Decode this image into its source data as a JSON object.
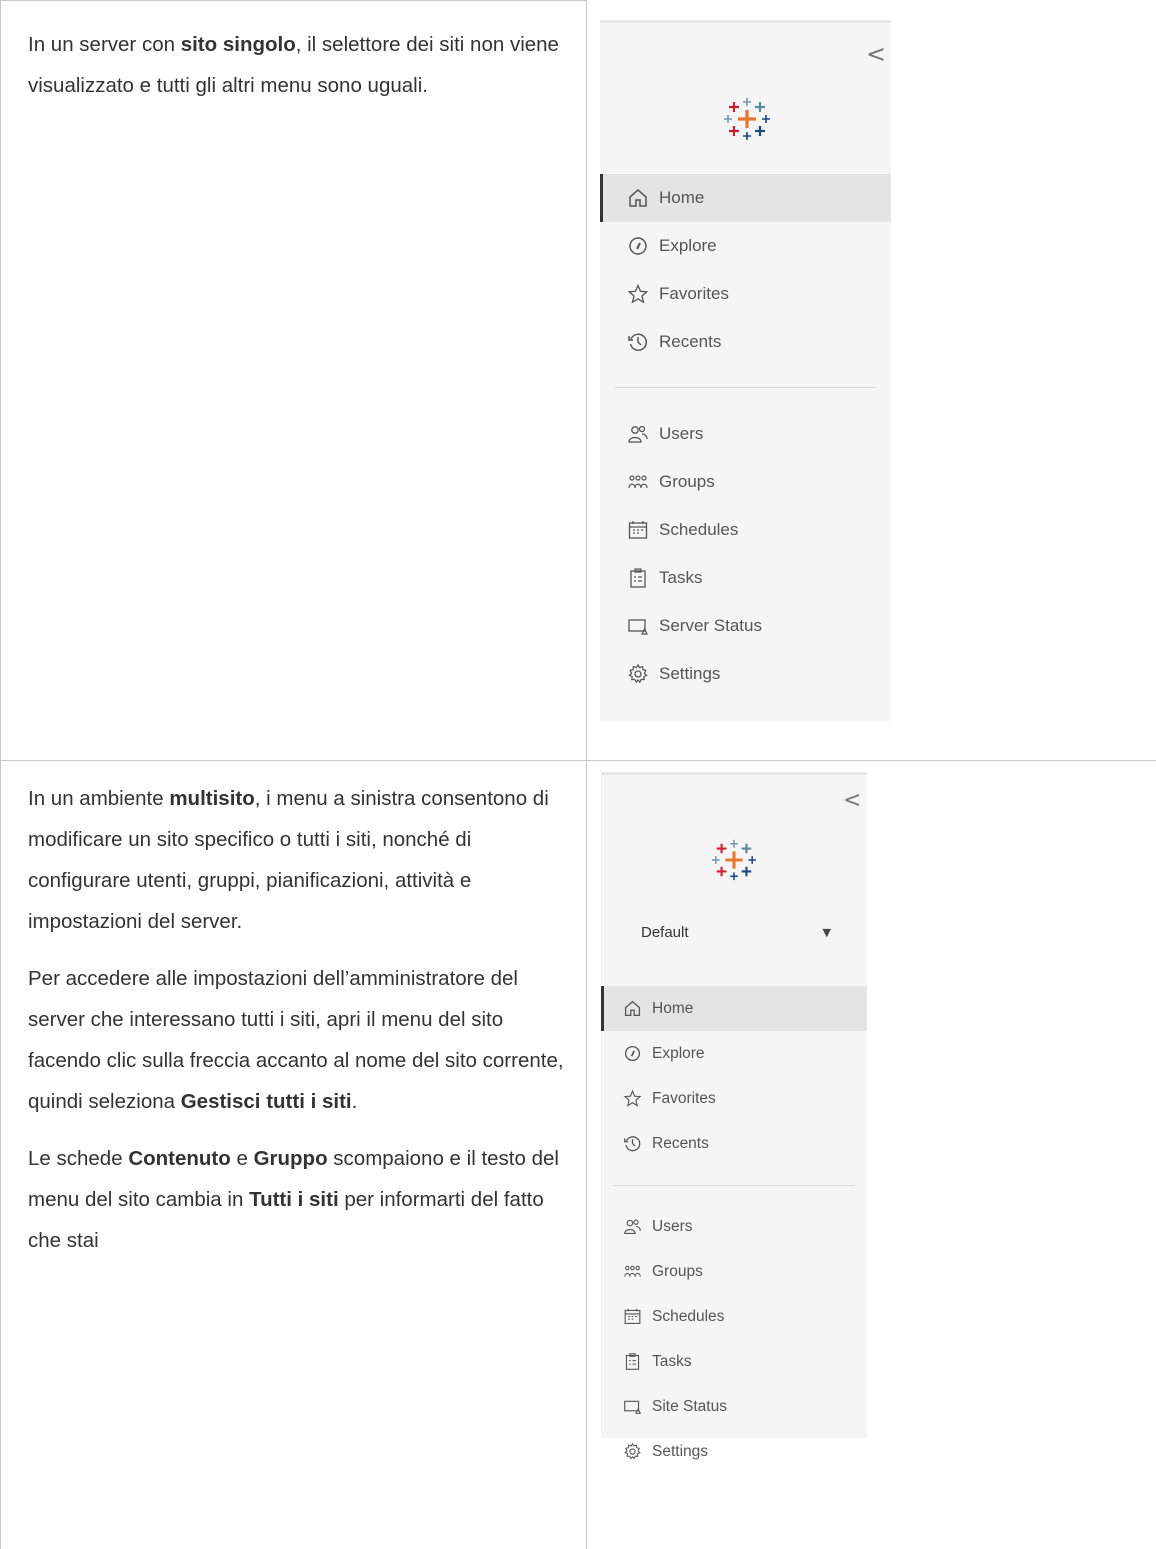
{
  "row1": {
    "paragraph": {
      "t1": "In un server con ",
      "b1": "sito singolo",
      "t2": ", il selettore dei siti non viene visualizzato e tutti gli altri menu sono uguali."
    },
    "sidebar": {
      "collapse_glyph": "<",
      "nav_items": [
        {
          "label": "Home",
          "icon": "home-icon"
        },
        {
          "label": "Explore",
          "icon": "compass-icon"
        },
        {
          "label": "Favorites",
          "icon": "star-icon"
        },
        {
          "label": "Recents",
          "icon": "clock-history-icon"
        }
      ],
      "admin_items": [
        {
          "label": "Users",
          "icon": "users-icon"
        },
        {
          "label": "Groups",
          "icon": "groups-icon"
        },
        {
          "label": "Schedules",
          "icon": "calendar-icon"
        },
        {
          "label": "Tasks",
          "icon": "clipboard-icon"
        },
        {
          "label": "Server Status",
          "icon": "server-status-icon"
        },
        {
          "label": "Settings",
          "icon": "gear-icon"
        }
      ]
    }
  },
  "row2": {
    "para1": {
      "t1": "In un ambiente ",
      "b1": "multisito",
      "t2": ", i menu a sinistra consentono di modificare un sito specifico o tutti i siti, nonché di configurare utenti, gruppi, pianificazioni, attività e impostazioni del server."
    },
    "para2": {
      "t1": "Per accedere alle impostazioni dell’amministratore del server che interessano tutti i siti, apri il menu del sito facendo clic sulla freccia accanto al nome del sito corrente, quindi seleziona ",
      "b1": "Gestisci tutti i siti",
      "t2": "."
    },
    "para3": {
      "t1": "Le schede ",
      "b1": "Contenuto",
      "t2": " e ",
      "b2": "Gruppo",
      "t3": " scompaiono e il testo del menu del sito cambia in ",
      "b3": "Tutti i siti",
      "t4": " per informarti del fatto che stai"
    },
    "sidebar": {
      "collapse_glyph": "<",
      "site_selector": {
        "value": "Default",
        "caret": "▼"
      },
      "nav_items": [
        {
          "label": "Home",
          "icon": "home-icon"
        },
        {
          "label": "Explore",
          "icon": "compass-icon"
        },
        {
          "label": "Favorites",
          "icon": "star-icon"
        },
        {
          "label": "Recents",
          "icon": "clock-history-icon"
        }
      ],
      "admin_items": [
        {
          "label": "Users",
          "icon": "users-icon"
        },
        {
          "label": "Groups",
          "icon": "groups-icon"
        },
        {
          "label": "Schedules",
          "icon": "calendar-icon"
        },
        {
          "label": "Tasks",
          "icon": "clipboard-icon"
        },
        {
          "label": "Site Status",
          "icon": "server-status-icon"
        },
        {
          "label": "Settings",
          "icon": "gear-icon"
        }
      ]
    }
  },
  "colors": {
    "text": "#333333",
    "panel_bg": "#f5f5f5",
    "active_bg": "#e4e4e4",
    "active_bar": "#333333",
    "logo_blue": "#1f457e",
    "logo_orange": "#e8762d",
    "logo_red": "#c72037",
    "logo_teal": "#5b879b",
    "logo_light_blue": "#7099a6"
  }
}
